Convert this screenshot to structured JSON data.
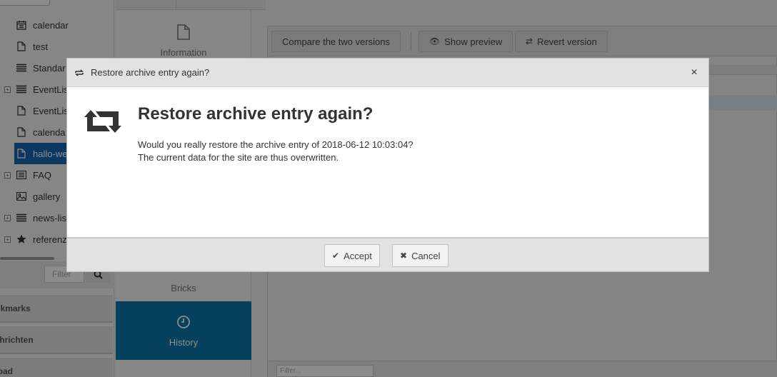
{
  "tree": {
    "items": [
      {
        "label": "calendar",
        "icon": "calendar-icon",
        "expandable": false
      },
      {
        "label": "test",
        "icon": "document-icon",
        "expandable": false
      },
      {
        "label": "Standar",
        "icon": "list-icon",
        "expandable": false
      },
      {
        "label": "EventLis",
        "icon": "list-icon",
        "expandable": true
      },
      {
        "label": "EventLis",
        "icon": "document-icon",
        "expandable": false
      },
      {
        "label": "calenda",
        "icon": "document-icon",
        "expandable": false
      },
      {
        "label": "hallo-we",
        "icon": "document-icon",
        "expandable": false,
        "selected": true
      },
      {
        "label": "FAQ",
        "icon": "list-icon",
        "expandable": true
      },
      {
        "label": "gallery",
        "icon": "image-icon",
        "expandable": false
      },
      {
        "label": "news-lis",
        "icon": "list-icon",
        "expandable": true
      },
      {
        "label": "referenz",
        "icon": "star-icon",
        "expandable": true
      }
    ]
  },
  "sidebar": {
    "filter_placeholder": "Filter",
    "accordions": [
      "ookmarks",
      "achrichten",
      "pload"
    ]
  },
  "middle": {
    "tabs": [
      {
        "label": "Information",
        "icon": "document-icon"
      },
      {
        "label": "Bricks",
        "icon": "bricks-icon"
      },
      {
        "label": "History",
        "icon": "clock-icon",
        "active": true
      }
    ]
  },
  "main": {
    "toolbar": {
      "compare_label": "Compare the two versions",
      "preview_label": "Show preview",
      "revert_label": "Revert version"
    },
    "filter_placeholder": "Filter..."
  },
  "dialog": {
    "title": "Restore archive entry again?",
    "heading": "Restore archive entry again?",
    "message_line1": "Would you really restore the archive entry of 2018-06-12 10:03:04?",
    "message_line2": "The current data for the site are thus overwritten.",
    "close_glyph": "×",
    "accept_label": "Accept",
    "cancel_label": "Cancel"
  },
  "colors": {
    "selected_tree_bg": "#1565b0",
    "active_tab_bg": "#0a77a8",
    "overlay": "rgba(0,0,0,0.45)"
  }
}
